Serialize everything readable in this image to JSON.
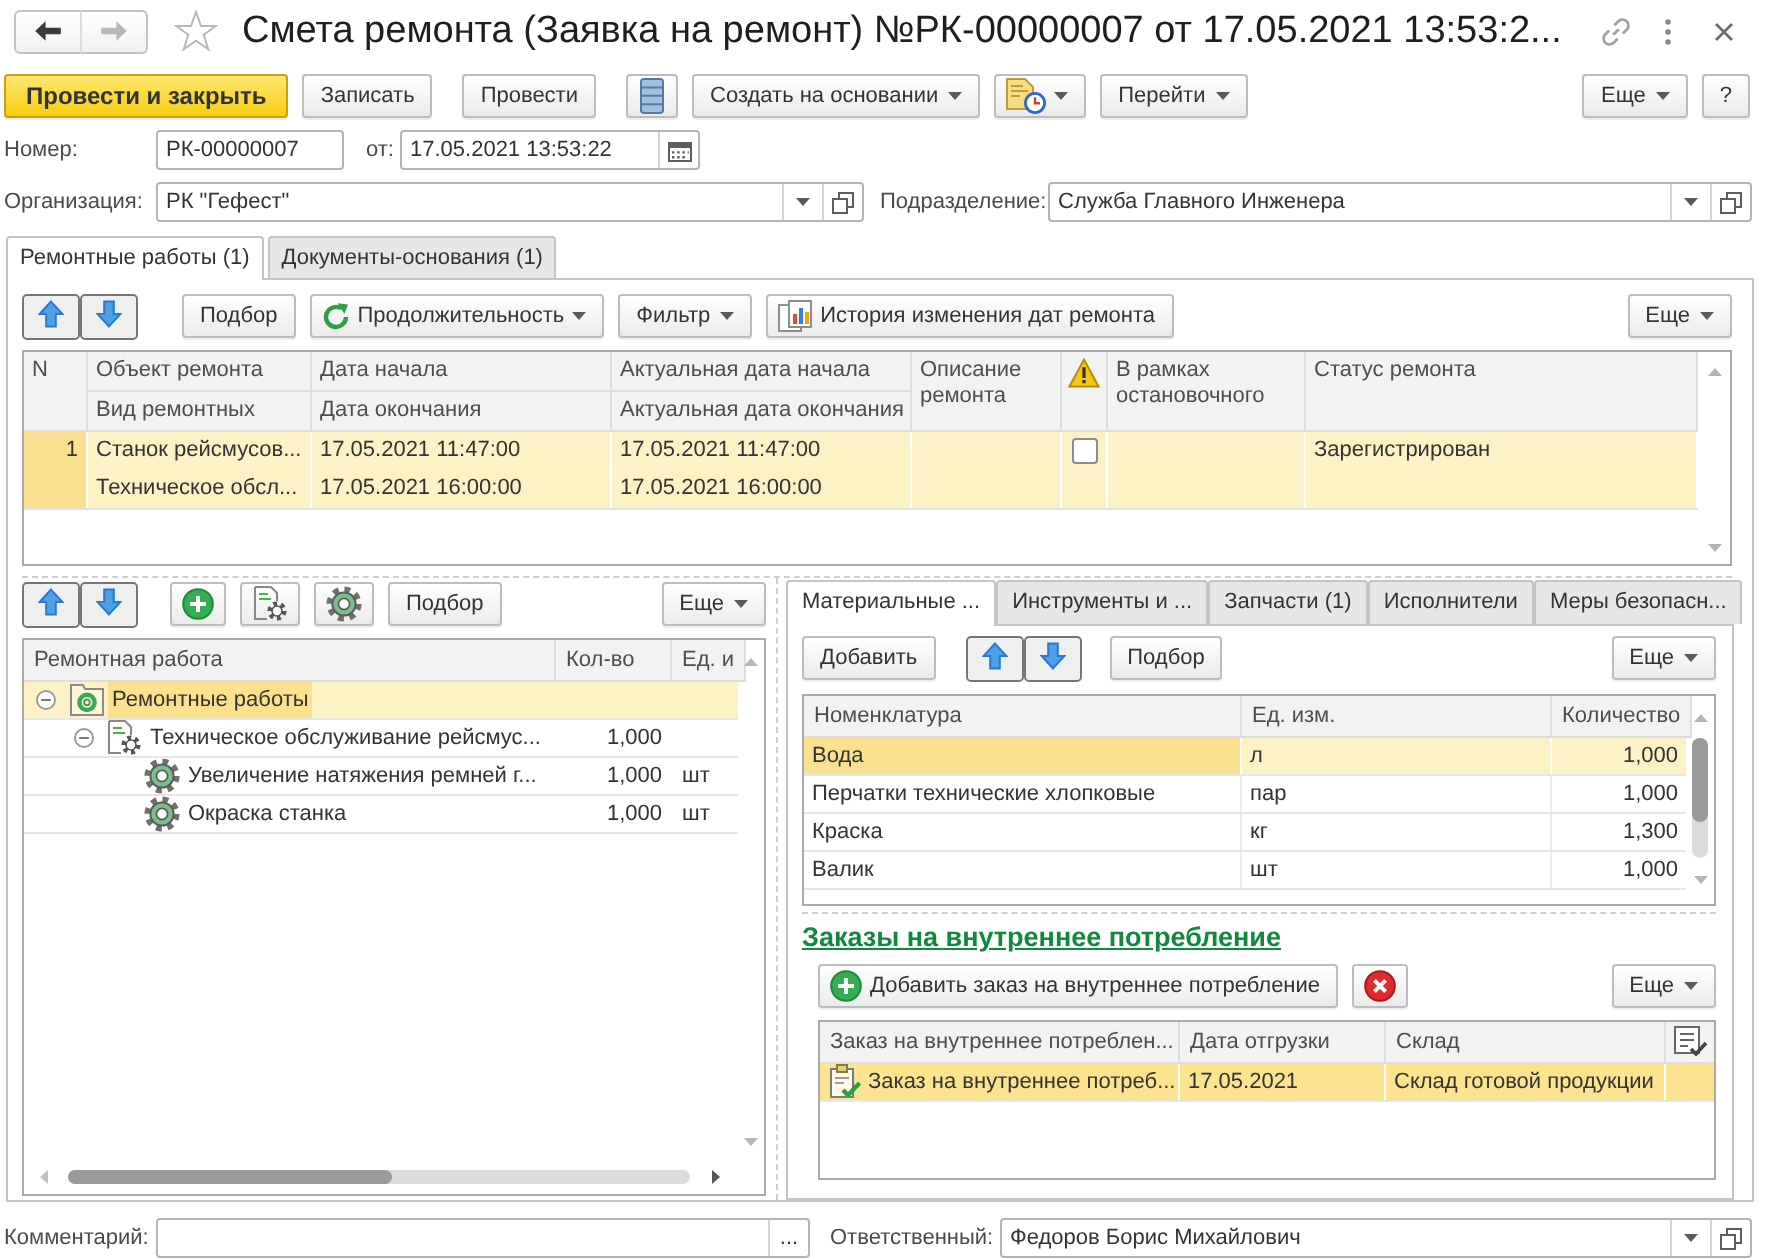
{
  "window": {
    "title": "Смета ремонта (Заявка на ремонт) №РК-00000007 от 17.05.2021 13:53:2...",
    "navigation": [
      {
        "kind": "back",
        "disabled": false
      },
      {
        "kind": "forward",
        "disabled": true
      }
    ]
  },
  "command_bar": {
    "left": [
      {
        "kind": "primary",
        "label": "Провести и закрыть"
      },
      {
        "kind": "button",
        "label": "Записать",
        "dropdown": false
      },
      {
        "kind": "button",
        "label": "Провести",
        "dropdown": false
      },
      {
        "kind": "journal"
      },
      {
        "kind": "button",
        "label": "Создать на основании",
        "dropdown": true
      },
      {
        "kind": "attachments",
        "dropdown": true
      },
      {
        "kind": "button",
        "label": "Перейти",
        "dropdown": true
      }
    ],
    "right": [
      {
        "kind": "button",
        "label": "Еще",
        "dropdown": true
      },
      {
        "kind": "button",
        "label": "?",
        "dropdown": false
      }
    ]
  },
  "header": {
    "number": {
      "label": "Номер:",
      "value": "РК-00000007"
    },
    "date": {
      "label": "от:",
      "value": "17.05.2021 13:53:22"
    },
    "organization": {
      "label": "Организация:",
      "value": "РК \"Гефест\""
    },
    "department": {
      "label": "Подразделение:",
      "value": "Служба Главного Инженера"
    }
  },
  "tabs": [
    {
      "label": "Ремонтные работы (1)",
      "selected": true
    },
    {
      "label": "Документы-основания (1)",
      "selected": false
    }
  ],
  "repairs": {
    "toolbar": {
      "left": [
        {
          "kind": "arrows"
        },
        {
          "kind": "button",
          "label": "Подбор",
          "dropdown": false
        },
        {
          "kind": "refresh",
          "label": "Продолжительность",
          "dropdown": true
        },
        {
          "kind": "button",
          "label": "Фильтр",
          "dropdown": true
        },
        {
          "kind": "history",
          "label": "История изменения дат ремонта"
        }
      ],
      "right": [
        {
          "kind": "button",
          "label": "Еще",
          "dropdown": true
        }
      ]
    },
    "table": {
      "columns": [
        {
          "kind": "text",
          "label": "N"
        },
        {
          "kind": "text",
          "label": "Объект ремонта",
          "label_2": "Вид ремонтных"
        },
        {
          "kind": "text",
          "label": "Дата начала",
          "label_2": "Дата окончания"
        },
        {
          "kind": "text",
          "label": "Актуальная дата начала",
          "label_2": "Актуальная дата окончания"
        },
        {
          "kind": "text",
          "label": "Описание ремонта"
        },
        {
          "kind": "warning"
        },
        {
          "kind": "text",
          "label": "В рамках остановочного"
        },
        {
          "kind": "text",
          "label": "Статус ремонта"
        }
      ],
      "rows": [
        {
          "selected": true,
          "number": "1",
          "object": "Станок рейсмусов...",
          "repair_type": "Техническое обсл...",
          "start_date": "17.05.2021 11:47:00",
          "end_date": "17.05.2021 16:00:00",
          "actual_start": "17.05.2021 11:47:00",
          "actual_end": "17.05.2021 16:00:00",
          "in_shutdown": false,
          "status": "Зарегистрирован"
        }
      ]
    }
  },
  "works": {
    "toolbar": {
      "left": [
        {
          "kind": "arrows"
        },
        {
          "kind": "add"
        },
        {
          "kind": "operation"
        },
        {
          "kind": "work"
        },
        {
          "kind": "button",
          "label": "Подбор",
          "dropdown": false
        }
      ],
      "right": [
        {
          "kind": "button",
          "label": "Еще",
          "dropdown": true
        }
      ]
    },
    "tree": {
      "columns": [
        "Ремонтная работа",
        "Кол-во",
        "Ед. и"
      ],
      "items": [
        {
          "kind": "group",
          "label": "Ремонтные работы",
          "expanded": true,
          "selected": true,
          "children": [
            {
              "kind": "operation",
              "label": "Техническое обслуживание рейсмус...",
              "quantity": "1,000",
              "expanded": true,
              "selected": false,
              "children": [
                {
                  "kind": "work",
                  "label": "Увеличение натяжения ремней г...",
                  "quantity": "1,000",
                  "unit": "шт",
                  "selected": false
                },
                {
                  "kind": "work",
                  "label": "Окраска станка",
                  "quantity": "1,000",
                  "unit": "шт",
                  "selected": false
                }
              ]
            }
          ]
        }
      ]
    }
  },
  "details": {
    "tabs": [
      {
        "label": "Материальные ...",
        "selected": true
      },
      {
        "label": "Инструменты и ...",
        "selected": false
      },
      {
        "label": "Запчасти (1)",
        "selected": false
      },
      {
        "label": "Исполнители",
        "selected": false
      },
      {
        "label": "Меры безопасн...",
        "selected": false
      }
    ],
    "toolbar": {
      "left": [
        {
          "kind": "button",
          "label": "Добавить",
          "dropdown": false
        },
        {
          "kind": "arrows"
        },
        {
          "kind": "button",
          "label": "Подбор",
          "dropdown": false
        }
      ],
      "right": [
        {
          "kind": "button",
          "label": "Еще",
          "dropdown": true
        }
      ]
    },
    "table": {
      "columns": [
        "Номенклатура",
        "Ед. изм.",
        "Количество"
      ],
      "rows": [
        {
          "name": "Вода",
          "unit": "л",
          "quantity": "1,000",
          "selected": true
        },
        {
          "name": "Перчатки технические хлопковые",
          "unit": "пар",
          "quantity": "1,000",
          "selected": false
        },
        {
          "name": "Краска",
          "unit": "кг",
          "quantity": "1,300",
          "selected": false
        },
        {
          "name": "Валик",
          "unit": "шт",
          "quantity": "1,000",
          "selected": false
        }
      ]
    }
  },
  "orders": {
    "title": "Заказы на внутреннее потребление",
    "toolbar": {
      "left": [
        {
          "kind": "add",
          "label": "Добавить заказ на внутреннее потребление"
        },
        {
          "kind": "delete"
        }
      ],
      "right": [
        {
          "kind": "button",
          "label": "Еще",
          "dropdown": true
        }
      ]
    },
    "table": {
      "columns": [
        {
          "kind": "text",
          "label": "Заказ на внутреннее потреблен..."
        },
        {
          "kind": "text",
          "label": "Дата отгрузки"
        },
        {
          "kind": "text",
          "label": "Склад"
        },
        {
          "kind": "icon"
        }
      ],
      "rows": [
        {
          "document": "Заказ на внутреннее потреб...",
          "date": "17.05.2021",
          "warehouse": "Склад готовой продукции",
          "selected": true
        }
      ]
    }
  },
  "footer": {
    "comment": {
      "label": "Комментарий:",
      "action": "..."
    },
    "responsible": {
      "label": "Ответственный:",
      "value": "Федоров Борис Михайлович"
    }
  }
}
